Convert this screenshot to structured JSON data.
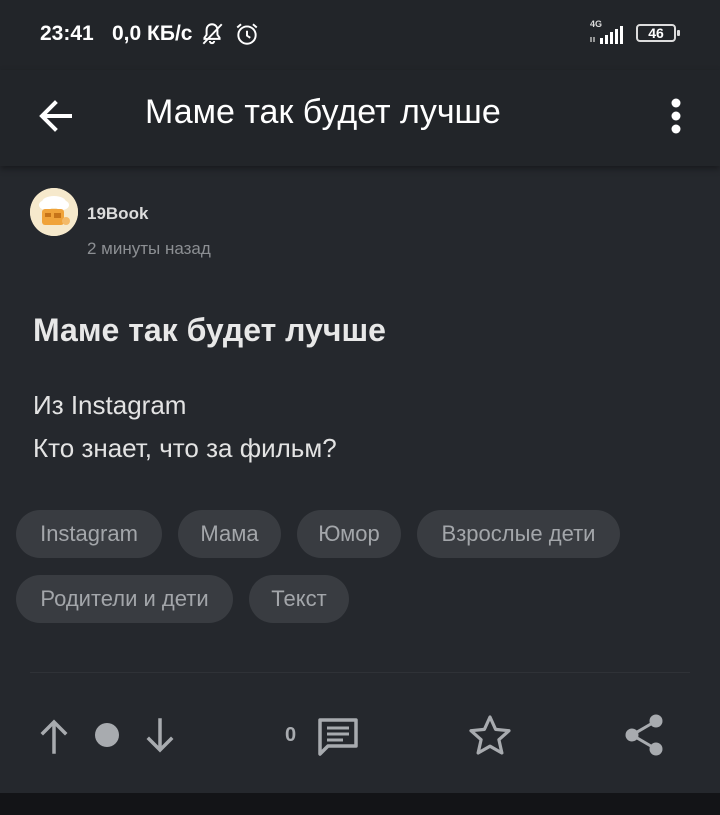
{
  "status_bar": {
    "time": "23:41",
    "net_speed": "0,0 КБ/с",
    "network_type": "4G",
    "battery_level": "46",
    "icons": [
      "bell-off-icon",
      "alarm-icon",
      "signal-icon",
      "battery-icon"
    ]
  },
  "app_bar": {
    "title": "Маме так будет лучше",
    "back_icon": "arrow-left-icon",
    "menu_icon": "more-vertical-icon"
  },
  "post": {
    "author": "19Book",
    "time_ago": "2 минуты назад",
    "title": "Маме так будет лучше",
    "body": [
      "Из Instagram",
      "Кто знает, что за фильм?"
    ],
    "tags": [
      "Instagram",
      "Мама",
      "Юмор",
      "Взрослые дети",
      "Родители и дети",
      "Текст"
    ]
  },
  "actions": {
    "comment_count": "0",
    "icons": [
      "arrow-up-icon",
      "rating-dot-icon",
      "arrow-down-icon",
      "comment-icon",
      "star-icon",
      "share-icon"
    ]
  },
  "colors": {
    "background": "#25282d",
    "appbar": "#222529",
    "tag_bg": "#393c41",
    "icon_gray": "#a8abaf"
  }
}
